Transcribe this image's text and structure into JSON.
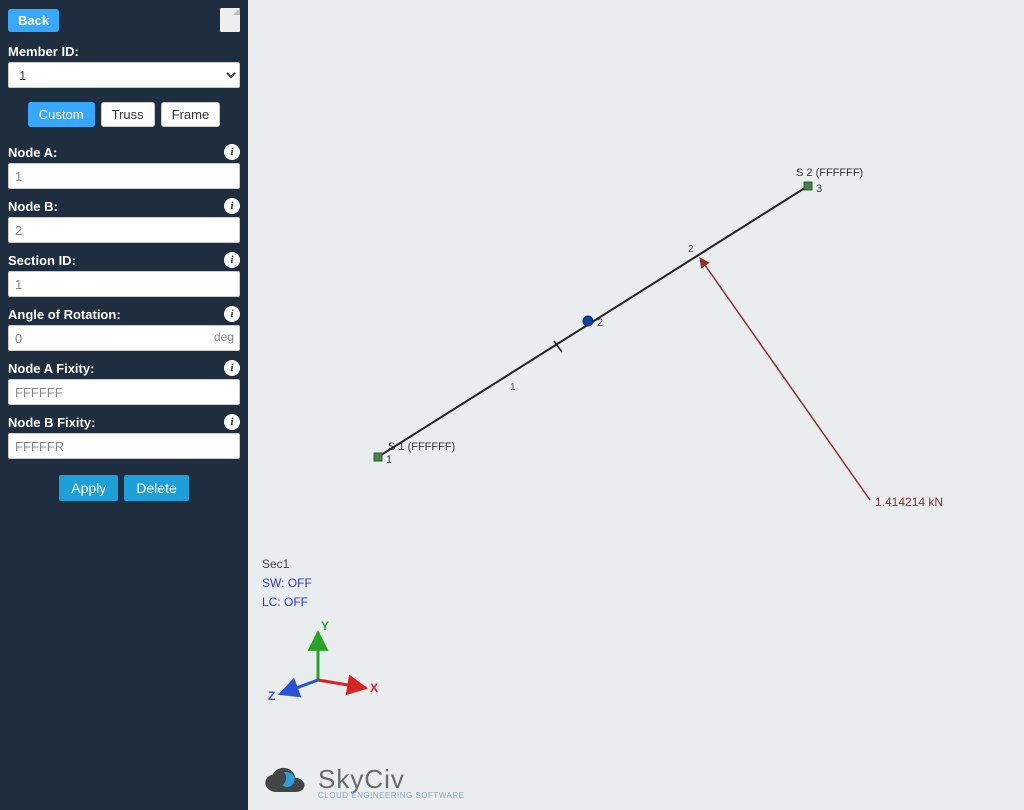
{
  "sidebar": {
    "back": "Back",
    "member_id_label": "Member ID:",
    "member_id_value": "1",
    "type_buttons": {
      "custom": "Custom",
      "truss": "Truss",
      "frame": "Frame"
    },
    "node_a_label": "Node A:",
    "node_a_value": "1",
    "node_b_label": "Node B:",
    "node_b_value": "2",
    "section_id_label": "Section ID:",
    "section_id_value": "1",
    "angle_label": "Angle of Rotation:",
    "angle_value": "0",
    "angle_unit": "deg",
    "fixity_a_label": "Node A Fixity:",
    "fixity_a_value": "FFFFFF",
    "fixity_b_label": "Node B Fixity:",
    "fixity_b_value": "FFFFFR",
    "apply": "Apply",
    "delete": "Delete"
  },
  "scene": {
    "support1_label": "S 1 (FFFFFF)",
    "support1_node": "1",
    "support2_label": "S 2 (FFFFFF)",
    "support2_node": "3",
    "node2_label": "2",
    "member1_label": "1",
    "member2_label": "2",
    "load_label": "1.414214 kN"
  },
  "status": {
    "sec": "Sec1",
    "sw": "SW: OFF",
    "lc": "LC: OFF"
  },
  "axes": {
    "x": "X",
    "y": "Y",
    "z": "Z"
  },
  "brand": {
    "name": "SkyCiv",
    "tag": "CLOUD ENGINEERING SOFTWARE"
  }
}
